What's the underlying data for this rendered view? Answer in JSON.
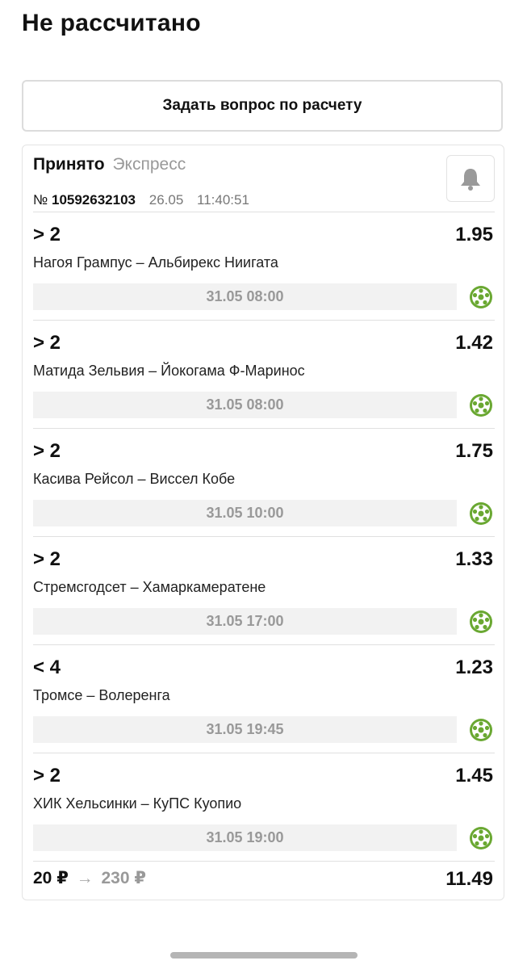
{
  "header": {
    "title": "Не рассчитано"
  },
  "ask_button": {
    "label": "Задать вопрос по расчету"
  },
  "bet": {
    "status": "Принято",
    "type": "Экспресс",
    "number_label": "№",
    "number": "10592632103",
    "date": "26.05",
    "time": "11:40:51",
    "bell_icon": "bell-icon",
    "events": [
      {
        "outcome": "> 2",
        "odds": "1.95",
        "match": "Нагоя Грампус – Альбирекс Ниигата",
        "start": "31.05 08:00",
        "sport_icon": "football-icon"
      },
      {
        "outcome": "> 2",
        "odds": "1.42",
        "match": "Матида Зельвия – Йокогама Ф-Маринос",
        "start": "31.05 08:00",
        "sport_icon": "football-icon"
      },
      {
        "outcome": "> 2",
        "odds": "1.75",
        "match": "Касива Рейсол – Виссел Кобе",
        "start": "31.05 10:00",
        "sport_icon": "football-icon"
      },
      {
        "outcome": "> 2",
        "odds": "1.33",
        "match": "Стремсгодсет – Хамаркамератене",
        "start": "31.05 17:00",
        "sport_icon": "football-icon"
      },
      {
        "outcome": "< 4",
        "odds": "1.23",
        "match": "Тромсе – Волеренга",
        "start": "31.05 19:45",
        "sport_icon": "football-icon"
      },
      {
        "outcome": "> 2",
        "odds": "1.45",
        "match": "ХИК Хельсинки – КуПС Куопио",
        "start": "31.05 19:00",
        "sport_icon": "football-icon"
      }
    ],
    "stake": "20 ₽",
    "arrow": "→",
    "payout": "230 ₽",
    "total_odds": "11.49"
  },
  "colors": {
    "sport_icon": "#6aa832",
    "muted_text": "#999999",
    "time_bg": "#f2f2f2"
  }
}
